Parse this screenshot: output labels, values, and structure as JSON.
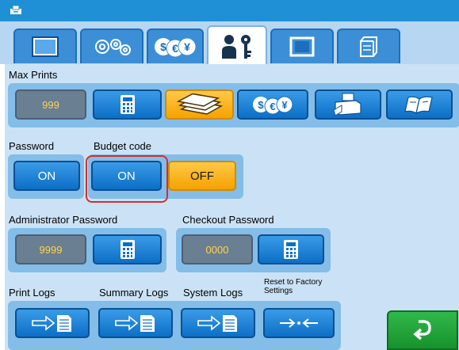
{
  "tabs": [
    {
      "icon": "display-icon"
    },
    {
      "icon": "gears-icon"
    },
    {
      "icon": "currency-icon"
    },
    {
      "icon": "user-key-icon",
      "active": true
    },
    {
      "icon": "frame-icon"
    },
    {
      "icon": "storage-icon"
    }
  ],
  "max_prints": {
    "label": "Max Prints",
    "value": "999",
    "buttons": [
      "calculator-icon",
      "paper-stack-icon",
      "currency-icon",
      "printer-icon",
      "book-icon"
    ],
    "selected": "paper-stack-icon"
  },
  "password": {
    "label": "Password",
    "button": "ON"
  },
  "budget_code": {
    "label": "Budget code",
    "on_label": "ON",
    "off_label": "OFF"
  },
  "admin_password": {
    "label": "Administrator Password",
    "value": "9999"
  },
  "checkout_password": {
    "label": "Checkout Password",
    "value": "0000"
  },
  "logs": {
    "print_logs": "Print Logs",
    "summary_logs": "Summary Logs",
    "system_logs": "System Logs",
    "reset_label": "Reset to Factory Settings"
  },
  "colors": {
    "accent_blue": "#0c6fc6",
    "selected_orange": "#f5a200",
    "panel": "#cbe2f6",
    "display": "#6b7f93",
    "return_green": "#17922c",
    "highlight_red": "#d32f2f"
  }
}
